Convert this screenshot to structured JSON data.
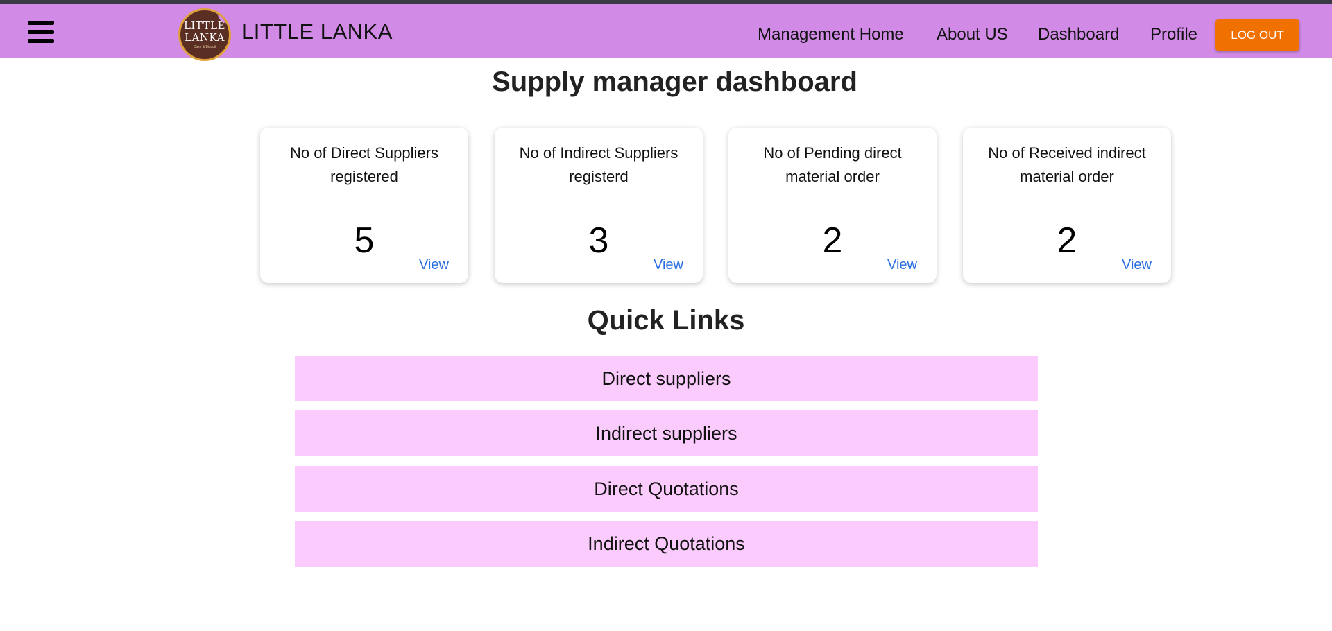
{
  "navbar": {
    "brand": "LITTLE LANKA",
    "logo": {
      "line1": "LITTLE",
      "line2": "LANKA",
      "tagline": "Cake & Biscuit"
    },
    "links": [
      "Management Home",
      "About US",
      "Dashboard",
      "Profile"
    ],
    "logout_label": "LOG OUT",
    "colors": {
      "bar": "#d18be6",
      "logout": "#f07000"
    }
  },
  "page": {
    "title": "Supply manager dashboard"
  },
  "cards": [
    {
      "label": "No of Direct Suppliers registered",
      "count": "5",
      "view": "View"
    },
    {
      "label": "No of Indirect Suppliers registerd",
      "count": "3",
      "view": "View"
    },
    {
      "label": "No of Pending direct material order",
      "count": "2",
      "view": "View"
    },
    {
      "label": "No of Received indirect material order",
      "count": "2",
      "view": "View"
    }
  ],
  "quick_links": {
    "title": "Quick Links",
    "items": [
      "Direct suppliers",
      "Indirect suppliers",
      "Direct Quotations",
      "Indirect Quotations"
    ],
    "color": "#fccbfd"
  }
}
